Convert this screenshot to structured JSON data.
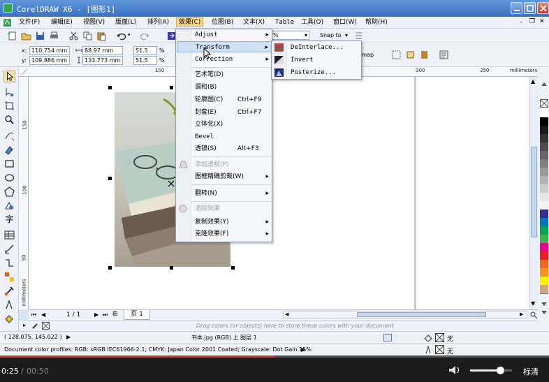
{
  "window": {
    "title": "CorelDRAW X6 - [图形1]"
  },
  "menubar": {
    "items": [
      {
        "label": "文件(F)"
      },
      {
        "label": "编辑(E)"
      },
      {
        "label": "视图(V)"
      },
      {
        "label": "版面(L)"
      },
      {
        "label": "排列(A)"
      },
      {
        "label": "效果(C)"
      },
      {
        "label": "位图(B)"
      },
      {
        "label": "文本(X)"
      },
      {
        "label": "Table"
      },
      {
        "label": "工具(O)"
      },
      {
        "label": "窗口(W)"
      },
      {
        "label": "帮助(H)"
      }
    ],
    "active_index": 5
  },
  "toolbar": {
    "zoom_value": "%",
    "snap_label": "Snap to",
    "bitmap_label": "itmap"
  },
  "propbar": {
    "x_label": "x:",
    "x_value": "110.754 mm",
    "y_label": "y:",
    "y_value": "109.886 mm",
    "w_value": "88.97 mm",
    "h_value": "133.773 mm",
    "sx_value": "51.5",
    "sy_value": "51.5",
    "pct": "%"
  },
  "ruler": {
    "top_ticks": [
      "100",
      "300",
      "350"
    ],
    "units": "millimeters",
    "left_ticks": [
      "150",
      "100",
      "50"
    ],
    "left_units": "millimeters"
  },
  "effects_menu": {
    "items": [
      {
        "label": "Adjust",
        "submenu": true,
        "mono": true
      },
      {
        "label": "Transform",
        "submenu": true,
        "mono": true,
        "highlight": true
      },
      {
        "label": "Correction",
        "submenu": true,
        "mono": true
      },
      {
        "label": "艺术笔(D)"
      },
      {
        "label": "调和(B)"
      },
      {
        "label": "轮廓图(C)",
        "shortcut": "Ctrl+F9"
      },
      {
        "label": "封套(E)",
        "shortcut": "Ctrl+F7"
      },
      {
        "label": "立体化(X)"
      },
      {
        "label": "Bevel",
        "mono": true
      },
      {
        "label": "透镜(S)",
        "shortcut": "Alt+F3"
      },
      {
        "label": "添加透视(P)",
        "disabled": true
      },
      {
        "label": "图框精确剪裁(W)",
        "submenu": true
      },
      {
        "label": "翻转(N)",
        "submenu": true
      },
      {
        "label": "清除效果",
        "disabled": true
      },
      {
        "label": "复制效果(Y)",
        "submenu": true
      },
      {
        "label": "克隆效果(F)",
        "submenu": true
      }
    ]
  },
  "transform_submenu": {
    "items": [
      {
        "label": "DeInterlace..."
      },
      {
        "label": "Invert"
      },
      {
        "label": "Posterize..."
      }
    ]
  },
  "pagenav": {
    "page_count": "1 / 1",
    "page_tab": "页 1"
  },
  "dropbar": {
    "hint": "Drag colors (or objects) here to store these colors with your document"
  },
  "status": {
    "coords": "( 128.075, 145.022 )",
    "object_info": "书本.jpg (RGB) 上 图层 1",
    "fill_label": "无",
    "outline_label": "无",
    "color_profiles": "Document color profiles: RGB: sRGB IEC61966-2.1; CMYK: Japan Color 2001 Coated; Grayscale: Dot Gain 15%"
  },
  "video": {
    "current": "0:25",
    "separator": "/",
    "total": "00:50",
    "quality": "标清",
    "volume": 0.72
  },
  "palette": {
    "colors": [
      "#ffffff",
      "#000000",
      "#1a1a1a",
      "#333333",
      "#4d4d4d",
      "#666666",
      "#808080",
      "#999999",
      "#b3b3b3",
      "#cccccc",
      "#e6e6e6",
      "#f2f2f2",
      "#2e3192",
      "#0072bc",
      "#00a651",
      "#39b54a",
      "#ec008c",
      "#ed1c24",
      "#f26522",
      "#f7941d",
      "#fff200",
      "#d2a679"
    ]
  }
}
